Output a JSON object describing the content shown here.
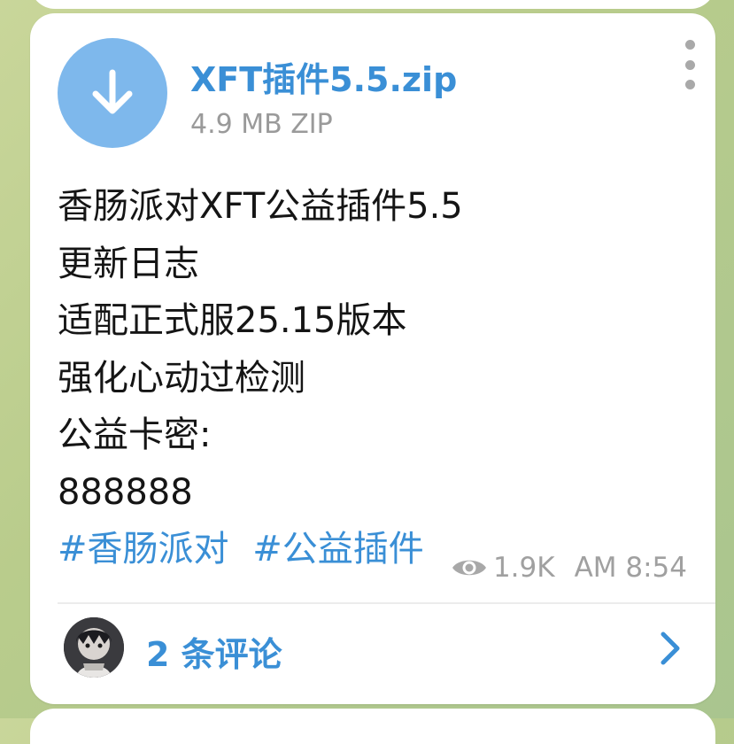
{
  "file": {
    "name": "XFT插件5.5.zip",
    "size_type": "4.9 MB ZIP",
    "icon": "download-arrow-icon"
  },
  "caption": {
    "lines": [
      "香肠派对XFT公益插件5.5",
      "更新日志",
      "适配正式服25.15版本",
      "强化心动过检测",
      "公益卡密:",
      "888888"
    ],
    "hashtags": [
      "#香肠派对",
      "#公益插件"
    ]
  },
  "meta": {
    "views": "1.9K",
    "time": "AM 8:54"
  },
  "comments": {
    "label": "2 条评论"
  },
  "colors": {
    "accent": "#3a8fd6",
    "download_circle": "#7eb8ec",
    "meta_gray": "#a0a0a0"
  }
}
